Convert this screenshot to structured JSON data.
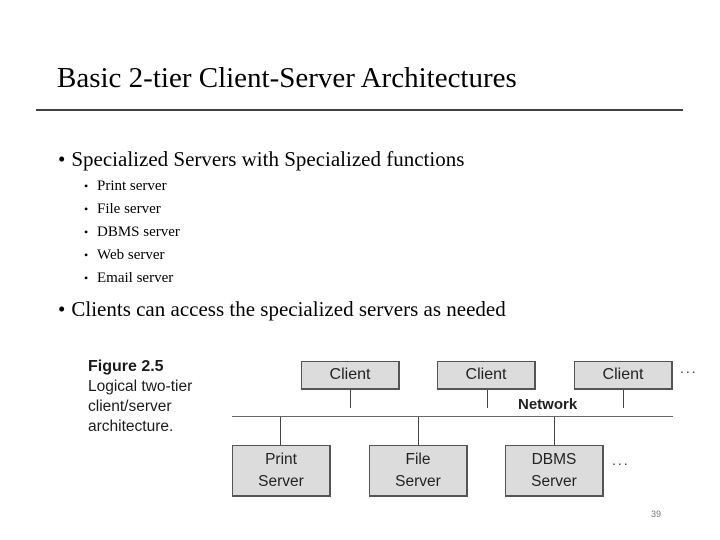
{
  "slide": {
    "title": "Basic 2-tier Client-Server Architectures",
    "bullets": [
      {
        "bullet": "•",
        "text": "Specialized Servers with Specialized functions",
        "sub": [
          {
            "bullet": "•",
            "text": "Print server"
          },
          {
            "bullet": "•",
            "text": "File server"
          },
          {
            "bullet": "•",
            "text": "DBMS server"
          },
          {
            "bullet": "•",
            "text": "Web server"
          },
          {
            "bullet": "•",
            "text": "Email server"
          }
        ]
      },
      {
        "bullet": "•",
        "text": "Clients can access the specialized servers as needed"
      }
    ],
    "page_number": "39"
  },
  "figure": {
    "number": "Figure 2.5",
    "caption_lines": [
      "Logical two-tier",
      "client/server",
      "architecture."
    ],
    "clients": [
      "Client",
      "Client",
      "Client"
    ],
    "network_label": "Network",
    "servers": [
      {
        "line1": "Print",
        "line2": "Server"
      },
      {
        "line1": "File",
        "line2": "Server"
      },
      {
        "line1": "DBMS",
        "line2": "Server"
      }
    ],
    "ellipsis": "...",
    "colors": {
      "box_fill": "#dcdcdc",
      "box_border": "#555555",
      "rule": "#404040"
    }
  }
}
